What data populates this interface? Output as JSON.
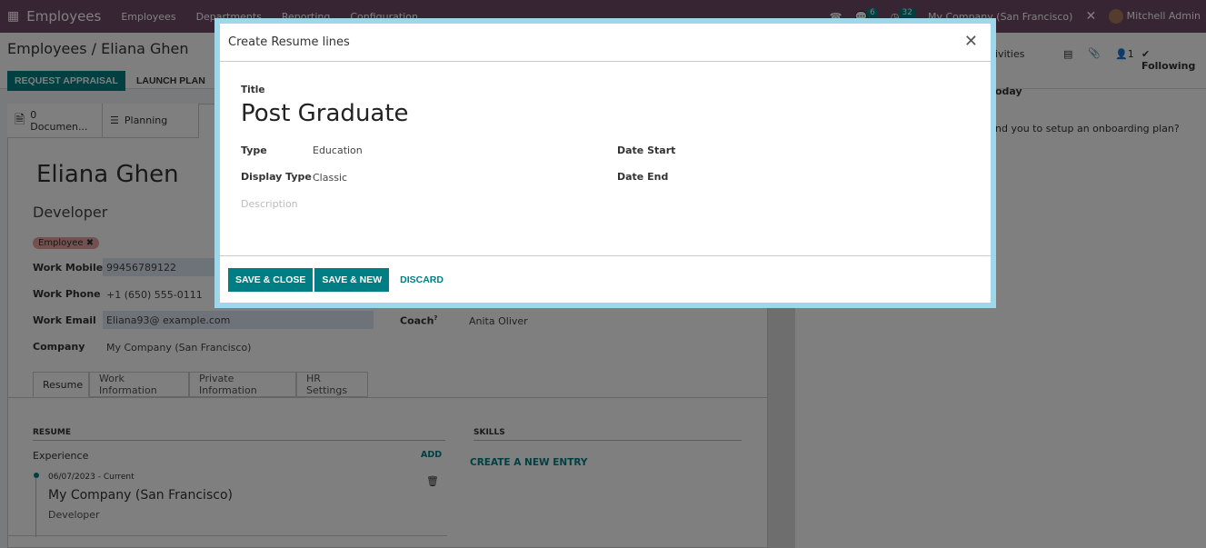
{
  "navbar": {
    "app": "Employees",
    "menu": [
      "Employees",
      "Departments",
      "Reporting",
      "Configuration"
    ],
    "messages_count": "6",
    "activities_count": "32",
    "company": "My Company (San Francisco)",
    "user": "Mitchell Admin"
  },
  "breadcrumb": {
    "parent": "Employees",
    "current": "Eliana Ghen"
  },
  "actions": {
    "request_appraisal": "REQUEST APPRAISAL",
    "launch_plan": "LAUNCH PLAN"
  },
  "smart_buttons": [
    {
      "count": "0",
      "label": "Documen..."
    },
    {
      "label": "Planning"
    }
  ],
  "chatter": {
    "activities": "ivities",
    "followers": "1",
    "following": "Following",
    "today": "oday",
    "message": "nd you to setup an onboarding plan?"
  },
  "employee": {
    "name": "Eliana Ghen",
    "job": "Developer",
    "tag": "Employee",
    "fields": [
      {
        "label": "Work Mobile",
        "value": "99456789122"
      },
      {
        "label": "Work Phone",
        "value": "+1 (650) 555-0111"
      },
      {
        "label": "Work Email",
        "value": "Eliana93@ example.com"
      },
      {
        "label": "Company",
        "value": "My Company (San Francisco)"
      }
    ],
    "coach_label": "Coach",
    "coach_help": "?",
    "coach": "Anita Oliver"
  },
  "tabs": [
    "Resume",
    "Work Information",
    "Private Information",
    "HR Settings"
  ],
  "resume": {
    "header": "RESUME",
    "section": "Experience",
    "add": "ADD",
    "entry": {
      "date": "06/07/2023 - Current",
      "title": "My Company (San Francisco)",
      "desc": "Developer"
    },
    "skills_header": "SKILLS",
    "create_entry": "CREATE A NEW ENTRY"
  },
  "modal": {
    "title": "Create Resume lines",
    "title_label": "Title",
    "title_value": "Post Graduate",
    "type_label": "Type",
    "type_value": "Education",
    "display_type_label": "Display Type",
    "display_type_value": "Classic",
    "description_placeholder": "Description",
    "date_start_label": "Date Start",
    "date_end_label": "Date End",
    "save_close": "SAVE & CLOSE",
    "save_new": "SAVE & NEW",
    "discard": "DISCARD"
  },
  "colors": {
    "brand": "#714b67",
    "accent": "#017e84",
    "modal_border": "#9dd7e9"
  }
}
